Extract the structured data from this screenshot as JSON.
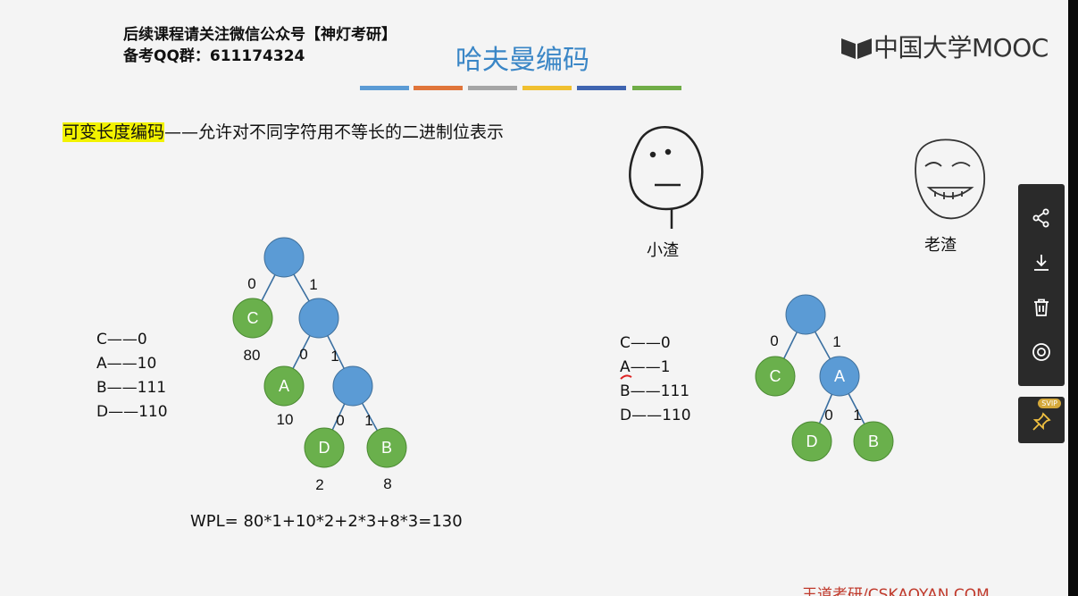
{
  "header": {
    "line1": "后续课程请关注微信公众号【神灯考研】",
    "line2": "备考QQ群：611174324"
  },
  "title": "哈夫曼编码",
  "title_bar_colors": [
    "#5b9bd5",
    "#e0753a",
    "#a5a5a5",
    "#f0c030",
    "#3f64b0",
    "#70ad47"
  ],
  "logo": "中国大学MOOC",
  "definition": {
    "term": "可变长度编码",
    "text": "——允许对不同字符用不等长的二进制位表示"
  },
  "left_codes": [
    "C——0",
    "A——10",
    "B——111",
    "D——110"
  ],
  "right_codes": [
    "C——0",
    "A——1",
    "B——111",
    "D——110"
  ],
  "tree_left": {
    "nodes": {
      "c": "C",
      "a": "A",
      "d": "D",
      "b": "B"
    },
    "edges": {
      "e1": "0",
      "e2": "1",
      "e3": "0",
      "e4": "1",
      "e5": "0",
      "e6": "1"
    },
    "weights": {
      "c": "80",
      "a": "10",
      "d": "2",
      "b": "8"
    }
  },
  "tree_right": {
    "nodes": {
      "c": "C",
      "a": "A",
      "d": "D",
      "b": "B"
    },
    "edges": {
      "e1": "0",
      "e2": "1",
      "e3": "0",
      "e4": "1"
    }
  },
  "faces": {
    "left": "小渣",
    "right": "老渣"
  },
  "wpl": "WPL= 80*1+10*2+2*3+8*3=130",
  "footer": "王道考研/CSKAOYAN.COM",
  "sidebar": {
    "icons": [
      "share-icon",
      "download-icon",
      "delete-icon",
      "view-icon",
      "pin-icon"
    ],
    "badge": "SVIP"
  },
  "colors": {
    "node_blue": "#5b9bd5",
    "node_green": "#6ab04c",
    "title_blue": "#3a86c6",
    "highlight": "#f2f200"
  }
}
